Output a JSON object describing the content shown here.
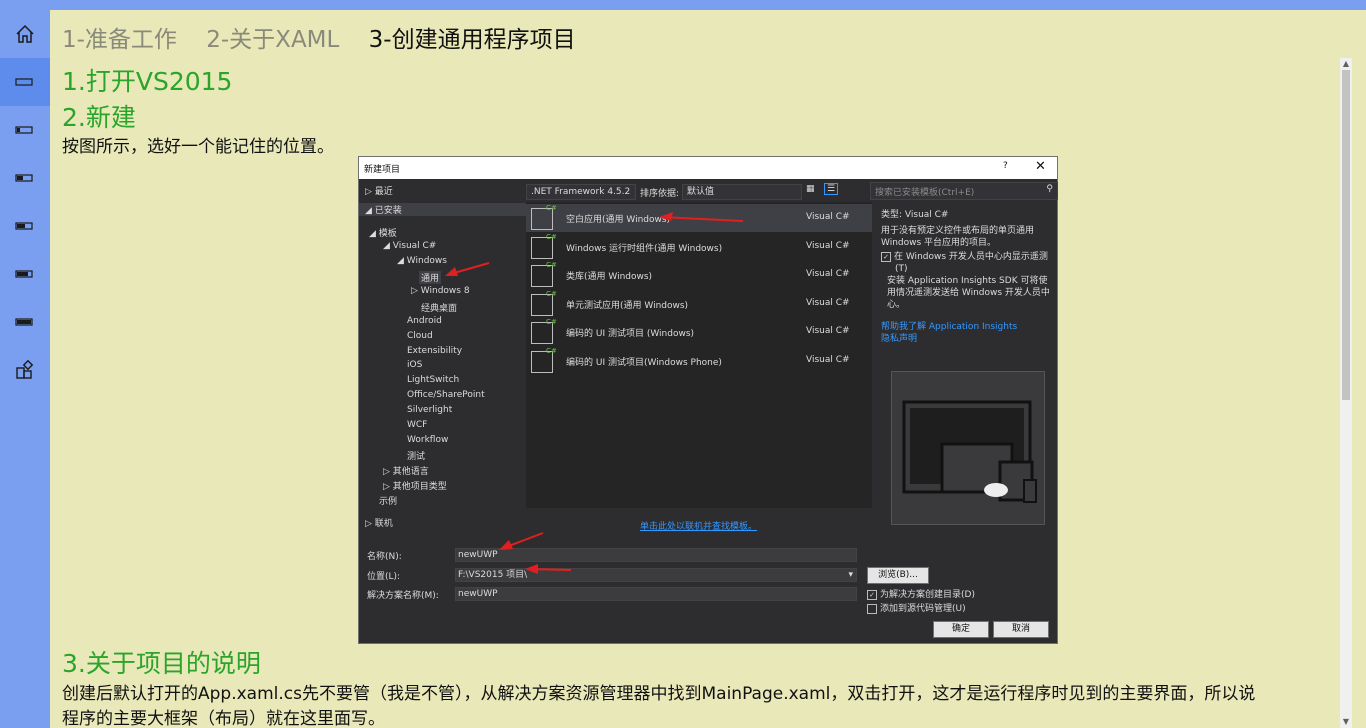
{
  "tabs": [
    "1-准备工作",
    "2-关于XAML",
    "3-创建通用程序项目"
  ],
  "active_tab": 2,
  "nav_icons": [
    "home-icon",
    "battery-empty-icon",
    "battery-low-icon",
    "battery-quarter-icon",
    "battery-half-icon",
    "battery-three-quarter-icon",
    "battery-full-icon",
    "add-tile-icon"
  ],
  "content": {
    "h1": "1.打开VS2015",
    "h2": "2.新建",
    "p1": "按图所示，选好一个能记住的位置。",
    "h3": "3.关于项目的说明",
    "p2": "创建后默认打开的App.xaml.cs先不要管（我是不管），从解决方案资源管理器中找到MainPage.xaml，双击打开，这才是运行程序时见到的主要界面，所以说",
    "p3": "程序的主要大框架（布局）就在这里面写。"
  },
  "dialog": {
    "title": "新建项目",
    "help": "?",
    "close": "✕",
    "tree": [
      "最近",
      "已安装",
      "模板",
      "Visual C#",
      "Windows",
      "通用",
      "Windows 8",
      "经典桌面",
      "Android",
      "Cloud",
      "Extensibility",
      "iOS",
      "LightSwitch",
      "Office/SharePoint",
      "Silverlight",
      "WCF",
      "Workflow",
      "测试",
      "其他语言",
      "其他项目类型",
      "示例",
      "联机"
    ],
    "framework": ".NET Framework 4.5.2",
    "sort_label": "排序依据:",
    "sort_value": "默认值",
    "search_placeholder": "搜索已安装模板(Ctrl+E)",
    "templates": [
      {
        "name": "空白应用(通用 Windows)",
        "lang": "Visual C#"
      },
      {
        "name": "Windows 运行时组件(通用 Windows)",
        "lang": "Visual C#"
      },
      {
        "name": "类库(通用 Windows)",
        "lang": "Visual C#"
      },
      {
        "name": "单元测试应用(通用 Windows)",
        "lang": "Visual C#"
      },
      {
        "name": "编码的 UI 测试项目 (Windows)",
        "lang": "Visual C#"
      },
      {
        "name": "编码的 UI 测试项目(Windows Phone)",
        "lang": "Visual C#"
      }
    ],
    "template_badge": "C#",
    "online_link": "单击此处以联机并查找模板。",
    "type_label": "类型:",
    "type_value": "Visual C#",
    "description": "用于没有预定义控件或布局的单页通用 Windows 平台应用的项目。",
    "telemetry_check": "在 Windows 开发人员中心内显示遥测",
    "telemetry_paren": "(T)",
    "insights_text": "安装 Application Insights SDK 可将使用情况遥测发送给 Windows 开发人员中心。",
    "help_link": "帮助我了解 Application Insights",
    "privacy_link": "隐私声明",
    "name_label": "名称(N):",
    "name_value": "newUWP",
    "location_label": "位置(L):",
    "location_value": "F:\\VS2015 项目\\",
    "solution_label": "解决方案名称(M):",
    "solution_value": "newUWP",
    "browse": "浏览(B)...",
    "create_dir": "为解决方案创建目录(D)",
    "add_source": "添加到源代码管理(U)",
    "ok": "确定",
    "cancel": "取消"
  }
}
